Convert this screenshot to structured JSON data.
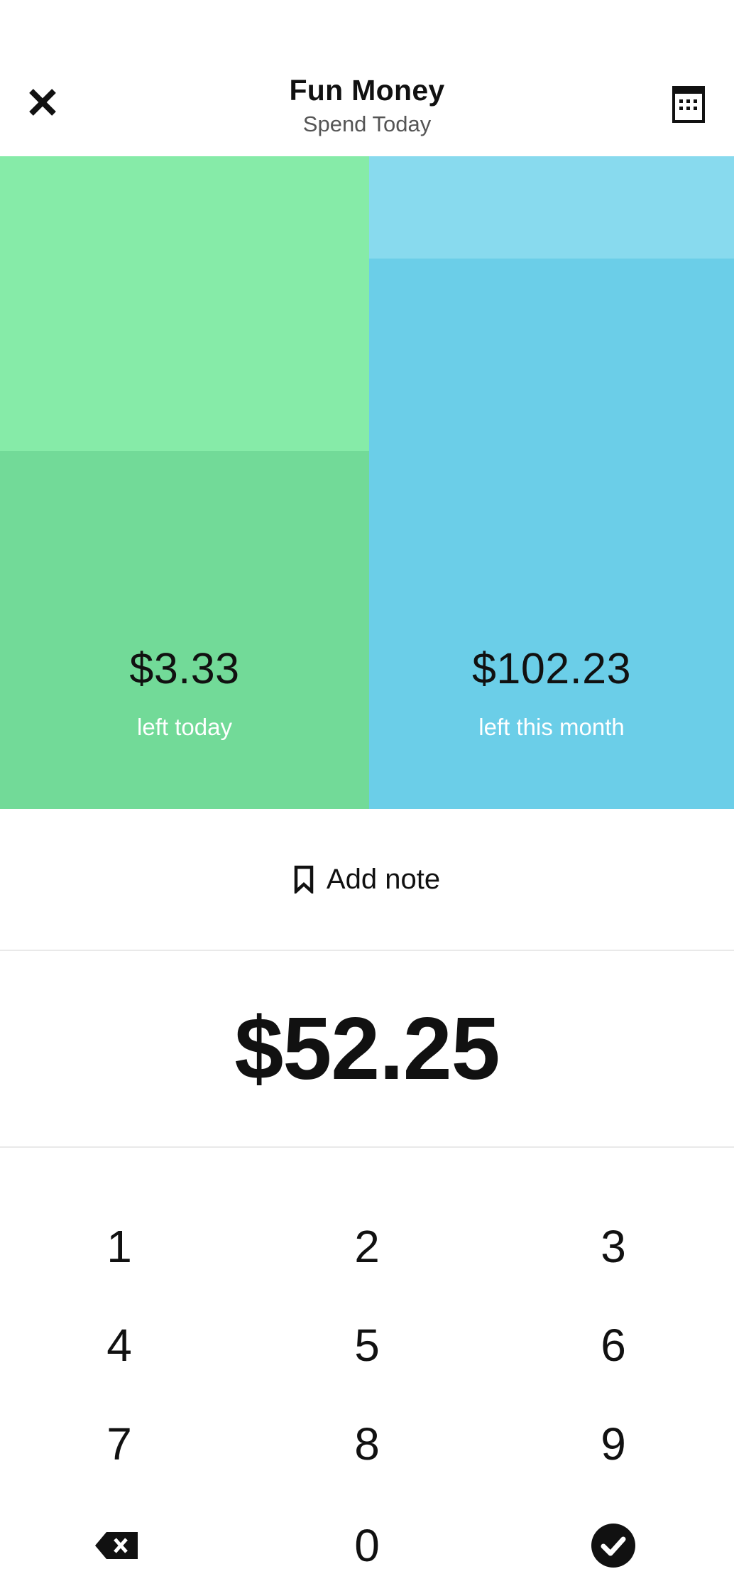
{
  "header": {
    "title": "Fun Money",
    "subtitle": "Spend Today"
  },
  "icons": {
    "close": "close-icon",
    "calendar": "calendar-icon",
    "bookmark": "bookmark-icon",
    "backspace": "backspace-icon",
    "confirm": "check-circle-icon"
  },
  "today_panel": {
    "amount": "$3.33",
    "label": "left today",
    "remaining_fraction": 0.548,
    "color_light": "#86EBA8",
    "color_fill": "#72DA98"
  },
  "month_panel": {
    "amount": "$102.23",
    "label": "left this month",
    "remaining_fraction": 0.843,
    "color_light": "#88DAEE",
    "color_fill": "#6BCEE8"
  },
  "note": {
    "label": "Add note"
  },
  "entry": {
    "value": "$52.25"
  },
  "keypad": {
    "keys": [
      "1",
      "2",
      "3",
      "4",
      "5",
      "6",
      "7",
      "8",
      "9",
      "0"
    ]
  }
}
